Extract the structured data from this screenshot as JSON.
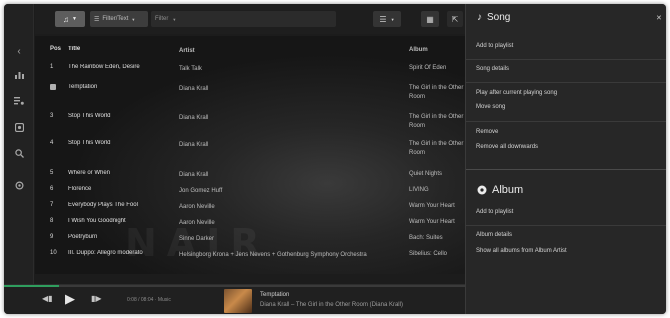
{
  "toolbar": {
    "menu_icon": "music-icon",
    "filter_chip_label": "Filter/Text",
    "search_placeholder": "Filter"
  },
  "rail": {
    "icons": [
      "back-arrow-icon",
      "chart-icon",
      "queue-icon",
      "library-icon",
      "search-icon",
      "settings-icon"
    ],
    "tooltip": "108"
  },
  "table": {
    "headers": {
      "pos": "Pos",
      "title": "Title",
      "artist": "Artist",
      "album": "Album"
    },
    "rows": [
      {
        "pos": "1",
        "title": "The Rainbow Eden, Desire",
        "artist": "Talk Talk",
        "album": "Spirit Of Eden"
      },
      {
        "pos": "",
        "title": "Temptation",
        "artist": "Diana Krall",
        "album": "The Girl in the Other Room"
      },
      {
        "pos": "3",
        "title": "Stop This World",
        "artist": "Diana Krall",
        "album": "The Girl in the Other Room"
      },
      {
        "pos": "4",
        "title": "Stop This World",
        "artist": "Diana Krall",
        "album": "The Girl in the Other Room"
      },
      {
        "pos": "5",
        "title": "Where or When",
        "artist": "Diana Krall",
        "album": "Quiet Nights"
      },
      {
        "pos": "6",
        "title": "Florence",
        "artist": "Jon Gomez Huff",
        "album": "LIVING"
      },
      {
        "pos": "7",
        "title": "Everybody Plays The Fool",
        "artist": "Aaron Neville",
        "album": "Warm Your Heart"
      },
      {
        "pos": "8",
        "title": "I Wish You Goodnight",
        "artist": "Aaron Neville",
        "album": "Warm Your Heart"
      },
      {
        "pos": "9",
        "title": "Poetryburn",
        "artist": "Sinne Darker",
        "album": "Bach: Suites"
      },
      {
        "pos": "10",
        "title": "III. Duppo: Allegro moderato",
        "artist": "Helsingborg Krona + Jens Nevens + Gothenburg Symphony Orchestra",
        "album": "Sibelius: Cello"
      }
    ]
  },
  "player": {
    "prev_icon": "skip-back-icon",
    "play_icon": "play-icon",
    "next_icon": "skip-forward-icon",
    "time_text": "0:08 / 08:04 · Music",
    "progress_fraction": 0.12,
    "track_title": "Temptation",
    "track_subtitle": "Diana Krall – The Girl in the Other Room (Diana Krall)"
  },
  "panel": {
    "song_header": "Song",
    "song_icon": "music-note-icon",
    "close_icon": "close-icon",
    "song_items": {
      "add_to_playlist": "Add to playlist",
      "song_details": "Song details",
      "play_after": "Play after current playing song",
      "move_song": "Move song",
      "remove": "Remove",
      "remove_all": "Remove all downwards"
    },
    "album_header": "Album",
    "album_icon": "disc-icon",
    "album_items": {
      "add_to_playlist": "Add to playlist",
      "album_details": "Album details",
      "show_all": "Show all albums from Album Artist"
    }
  },
  "colors": {
    "accent": "#2f9e5e",
    "background": "#1c1c1c",
    "panel": "#272727"
  }
}
